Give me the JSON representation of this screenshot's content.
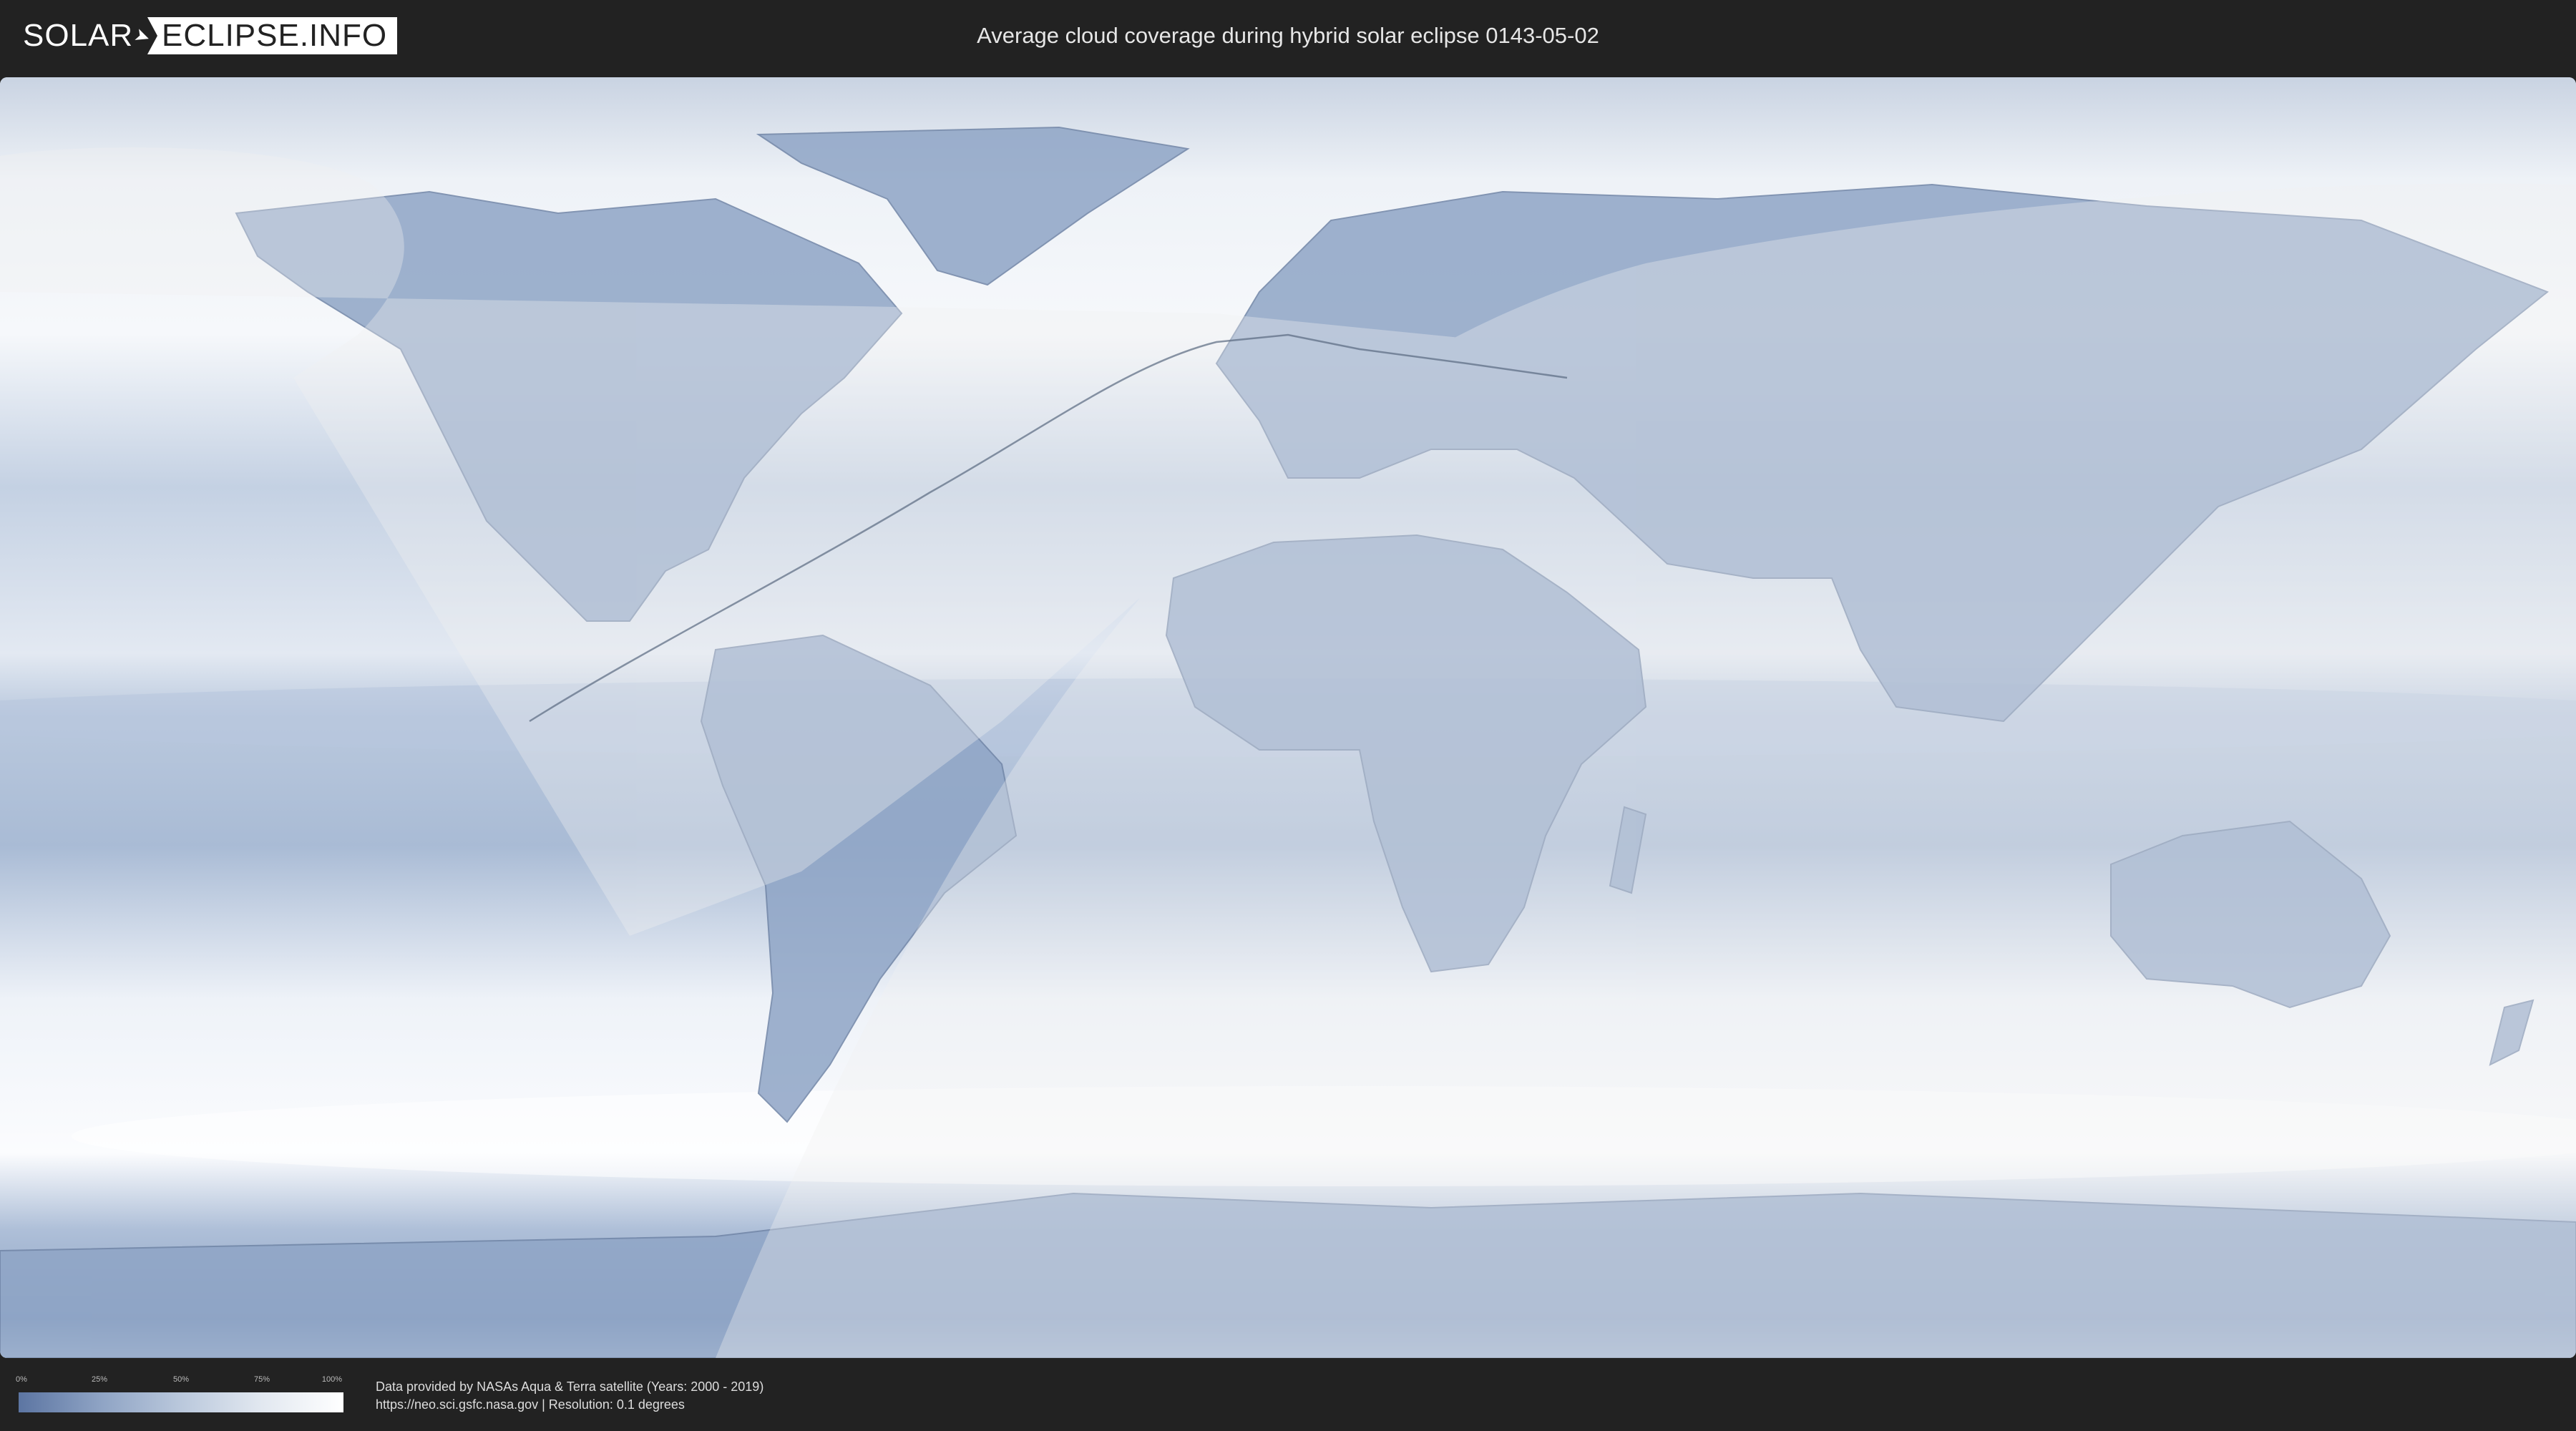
{
  "header": {
    "logo": {
      "part1": "SOLAR",
      "part2": "ECLIPSE.INFO"
    },
    "title": "Average cloud coverage during hybrid solar eclipse 0143-05-02"
  },
  "map": {
    "base_color": "#dfe6f0",
    "cloud_color_clear": "#5c75a2",
    "cloud_color_cloudy": "#ffffff",
    "eclipse_overlay_color": "#f2f2f2"
  },
  "legend": {
    "ticks": [
      "0%",
      "25%",
      "50%",
      "75%",
      "100%"
    ]
  },
  "credits": {
    "line1": "Data provided by NASAs Aqua & Terra satellite (Years: 2000 - 2019)",
    "line2": "https://neo.sci.gsfc.nasa.gov | Resolution: 0.1 degrees"
  }
}
